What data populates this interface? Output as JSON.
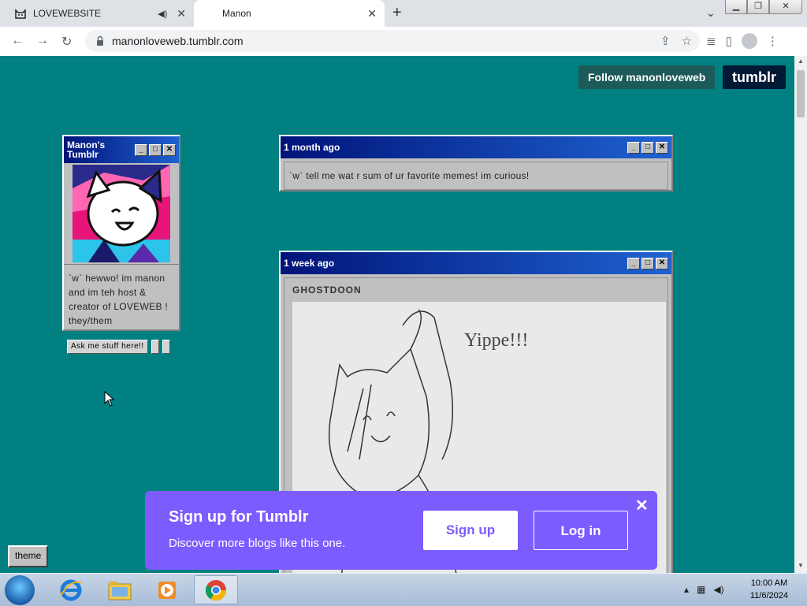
{
  "browser": {
    "tabs": [
      {
        "title": "LOVEWEBSITE",
        "active": false,
        "audio": true
      },
      {
        "title": "Manon",
        "active": true
      }
    ],
    "url": "manonloveweb.tumblr.com"
  },
  "header": {
    "follow_label": "Follow manonloveweb",
    "logo": "tumblr"
  },
  "sidebar": {
    "title": "Manon's Tumblr",
    "description": "`w` hewwo! im manon and im teh host & creator of LOVEWEB ! they/them",
    "ask_label": "Ask me stuff here!!"
  },
  "posts": [
    {
      "time": "1 month ago",
      "text": "`w` tell me wat r sum of ur favorite memes! im curious!"
    },
    {
      "time": "1 week ago",
      "blog": "GHOSTDOON",
      "image_caption": "Yippe!!!"
    }
  ],
  "theme_label": "theme",
  "signup": {
    "heading": "Sign up for Tumblr",
    "subtext": "Discover more blogs like this one.",
    "signup_label": "Sign up",
    "login_label": "Log in"
  },
  "taskbar": {
    "time": "10:00 AM",
    "date": "11/6/2024"
  },
  "colors": {
    "page_bg": "#008080",
    "signup_bg": "#7c5cff",
    "title_bar": "#00147a"
  }
}
